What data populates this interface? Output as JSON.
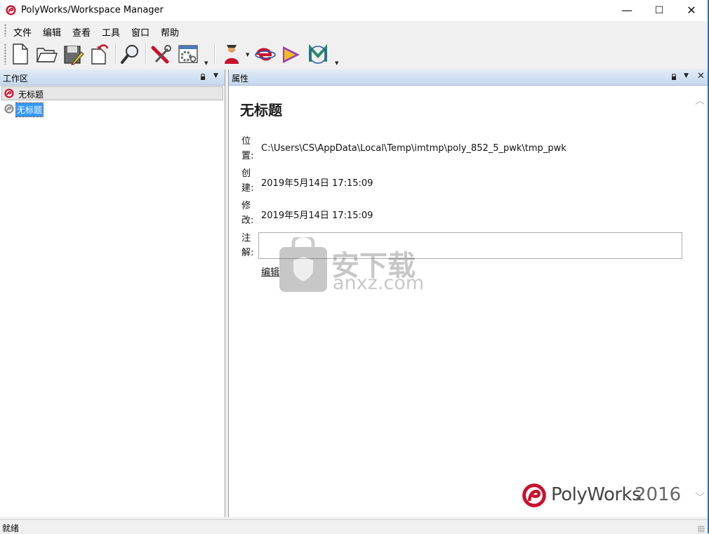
{
  "window": {
    "title": "PolyWorks/Workspace Manager",
    "minimize_glyph": "—",
    "maximize_glyph": "☐",
    "close_glyph": "✕"
  },
  "menu": [
    "文件",
    "编辑",
    "查看",
    "工具",
    "窗口",
    "帮助"
  ],
  "toolbar_icons": [
    "new-document-icon",
    "open-folder-icon",
    "save-icon",
    "revert-icon",
    "search-icon",
    "tools-icon",
    "settings-icon",
    "inspector-icon",
    "ie-icon",
    "modeler-icon",
    "im-icon"
  ],
  "workspace_pane": {
    "title": "工作区",
    "header_item": "无标题",
    "tree_item": "无标题"
  },
  "properties_pane": {
    "title": "属性",
    "heading": "无标题",
    "location_label": "位置:",
    "location_value": "C:\\Users\\CS\\AppData\\Local\\Temp\\imtmp\\poly_852_5_pwk\\tmp_pwk",
    "created_label": "创建:",
    "created_value": "2019年5月14日 17:15:09",
    "modified_label": "修改:",
    "modified_value": "2019年5月14日 17:15:09",
    "notes_label": "注解:",
    "notes_value": "",
    "edit_link": "编辑"
  },
  "watermark": {
    "text_cn": "安下载",
    "text_en": "anxz.com"
  },
  "brand": {
    "name": "PolyWorks",
    "version": "2016"
  },
  "status": {
    "text": "就绪"
  },
  "colors": {
    "brand_red": "#c8102e",
    "pane_header": "#c6d8ee",
    "selection": "#3399ff"
  }
}
